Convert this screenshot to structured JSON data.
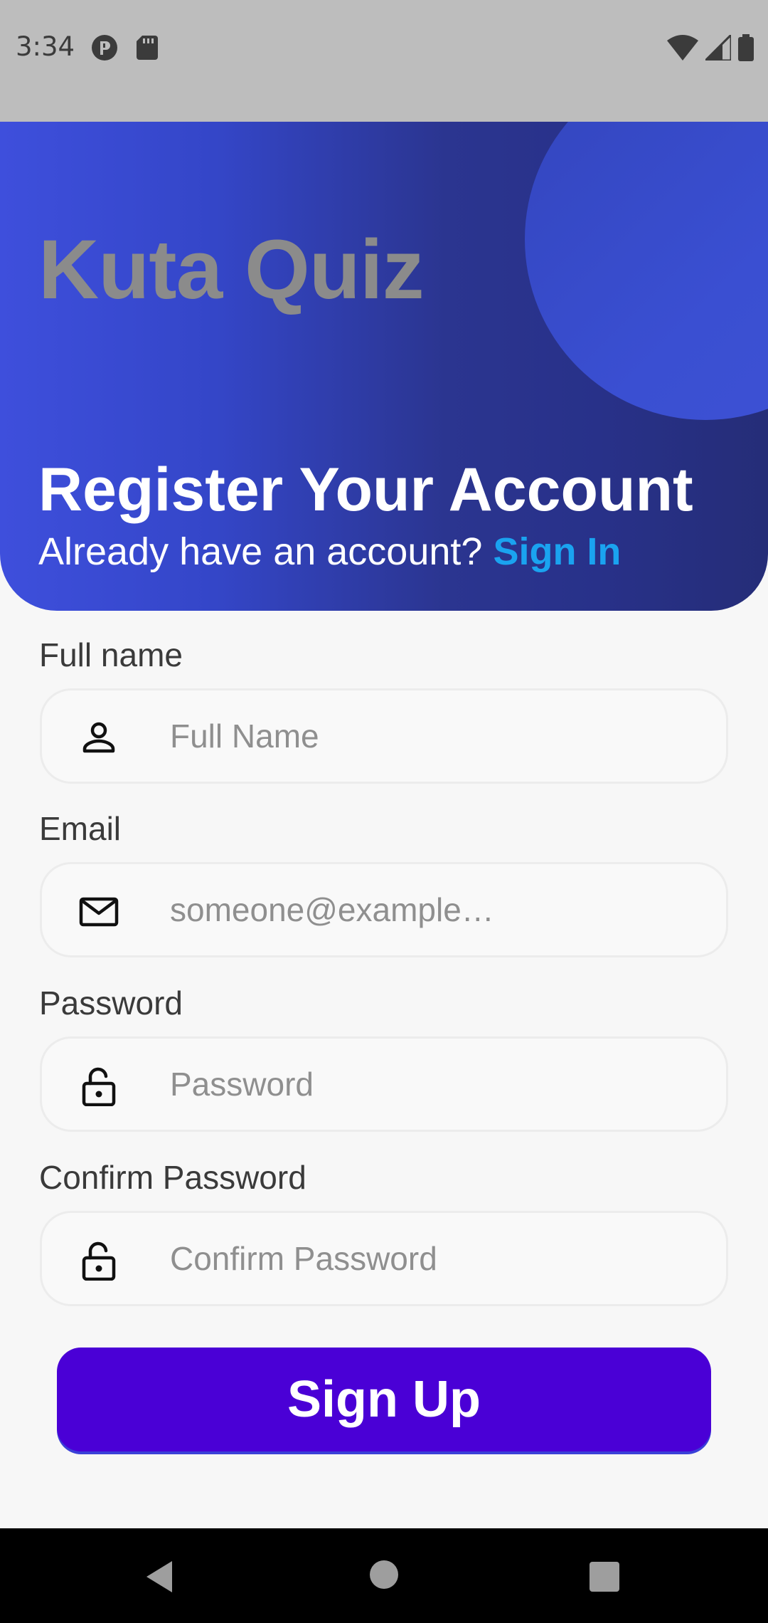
{
  "status_bar": {
    "time": "3:34"
  },
  "header": {
    "app_title": "Kuta Quiz",
    "heading": "Register Your Account",
    "prompt": "Already have an account? ",
    "signin_link": "Sign In"
  },
  "form": {
    "full_name": {
      "label": "Full name",
      "placeholder": "Full Name",
      "value": "",
      "icon": "person-icon"
    },
    "email": {
      "label": "Email",
      "placeholder": "someone@example…",
      "value": "",
      "icon": "mail-icon"
    },
    "password": {
      "label": "Password",
      "placeholder": "Password",
      "value": "",
      "icon": "lock-icon"
    },
    "confirm_password": {
      "label": "Confirm Password",
      "placeholder": "Confirm Password",
      "value": "",
      "icon": "lock-icon"
    },
    "submit_label": "Sign Up"
  },
  "colors": {
    "header_gradient_start": "#3e4fdc",
    "header_gradient_end": "#252d78",
    "app_title": "#8b8b8b",
    "link": "#1aa3f0",
    "button": "#4a00d6",
    "background": "#f7f7f7"
  },
  "nav_bar": {
    "icons": [
      "back-icon",
      "home-icon",
      "recents-icon"
    ]
  }
}
